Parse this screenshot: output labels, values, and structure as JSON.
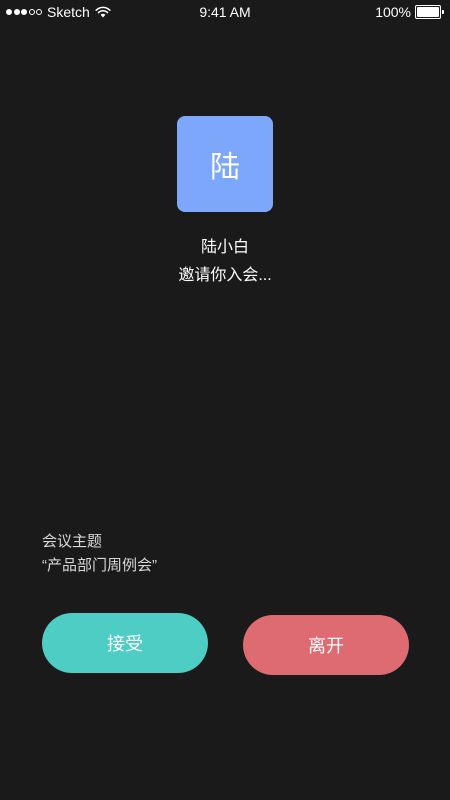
{
  "status_bar": {
    "carrier": "Sketch",
    "signal_filled": 3,
    "signal_total": 5,
    "time": "9:41 AM",
    "battery_percent": "100%",
    "battery_level": 1.0
  },
  "caller": {
    "avatar_text": "陆",
    "avatar_color": "#7da7fa",
    "name": "陆小白",
    "invite_message": "邀请你入会..."
  },
  "meeting": {
    "topic_label": "会议主题",
    "topic_value": "“产品部门周例会”"
  },
  "actions": {
    "accept_label": "接受",
    "accept_color": "#4ecdc4",
    "leave_label": "离开",
    "leave_color": "#de6b72"
  },
  "icons": {
    "wifi": "wifi-icon",
    "battery": "battery-icon",
    "signal": "signal-strength-icon"
  }
}
